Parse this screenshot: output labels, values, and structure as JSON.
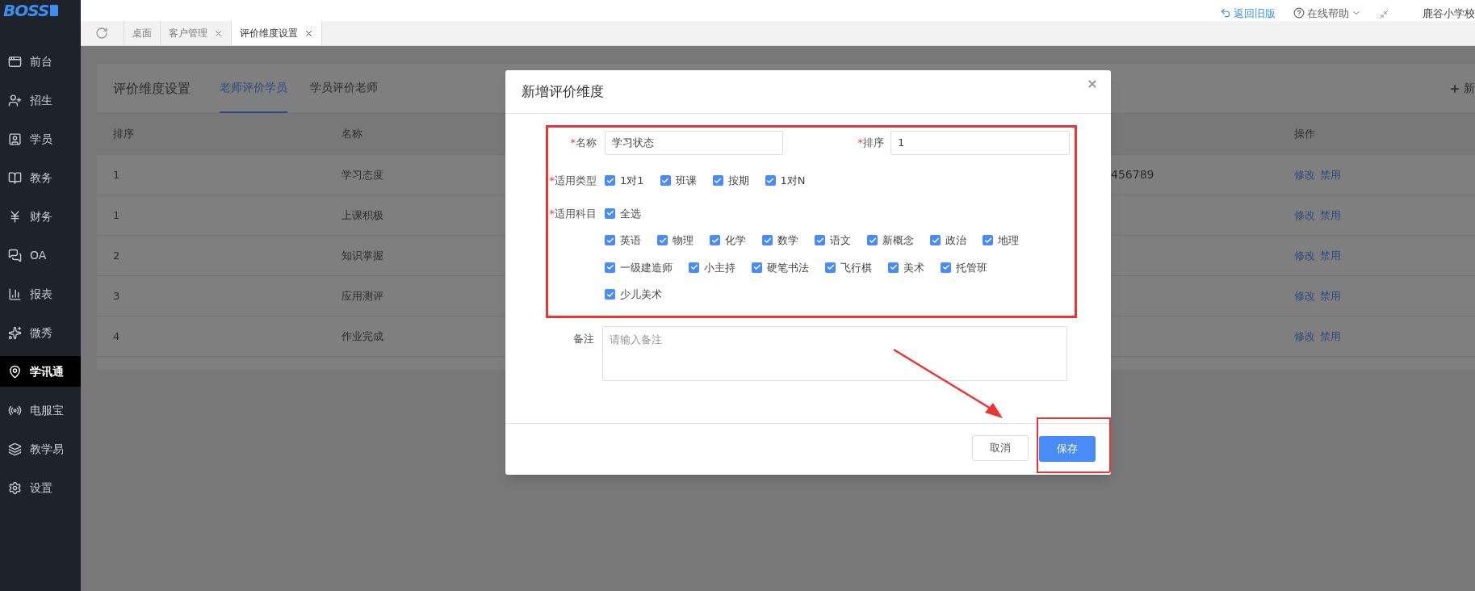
{
  "header": {
    "logo": "BOSS",
    "links": [
      {
        "label": "返回旧版"
      },
      {
        "label": "在线帮助"
      }
    ],
    "school": "鹿谷小学校"
  },
  "sidebar": {
    "items": [
      {
        "label": "前台",
        "selected": false
      },
      {
        "label": "招生",
        "selected": false
      },
      {
        "label": "学员",
        "selected": false
      },
      {
        "label": "教务",
        "selected": false
      },
      {
        "label": "财务",
        "selected": false
      },
      {
        "label": "OA",
        "selected": false
      },
      {
        "label": "报表",
        "selected": false
      },
      {
        "label": "微秀",
        "selected": false
      },
      {
        "label": "学讯通",
        "selected": true
      },
      {
        "label": "电服宝",
        "selected": false
      },
      {
        "label": "教学易",
        "selected": false
      },
      {
        "label": "设置",
        "selected": false
      }
    ]
  },
  "page_tabs": [
    {
      "label": "桌面",
      "selected": false,
      "closable": false
    },
    {
      "label": "客户管理",
      "selected": false,
      "closable": true
    },
    {
      "label": "评价维度设置",
      "selected": true,
      "closable": true
    }
  ],
  "panel": {
    "title": "评价维度设置",
    "tabs": [
      {
        "label": "老师评价学员",
        "selected": true
      },
      {
        "label": "学员评价老师",
        "selected": false
      }
    ],
    "add_button": "新",
    "table": {
      "columns": [
        "排序",
        "名称",
        "操作"
      ],
      "rows": [
        {
          "order": "1",
          "name": "学习态度",
          "column_3": "456789",
          "actions": [
            "修改",
            "禁用"
          ]
        },
        {
          "order": "1",
          "name": "上课积极",
          "actions": [
            "修改",
            "禁用"
          ]
        },
        {
          "order": "2",
          "name": "知识掌握",
          "actions": [
            "修改",
            "禁用"
          ]
        },
        {
          "order": "3",
          "name": "应用测评",
          "actions": [
            "修改",
            "禁用"
          ]
        },
        {
          "order": "4",
          "name": "作业完成",
          "actions": [
            "修改",
            "禁用"
          ]
        }
      ]
    }
  },
  "dialog": {
    "title": "新增评价维度",
    "fields": [
      {
        "mark": "*",
        "label": "名称",
        "value": "学习状态"
      },
      {
        "mark": "*",
        "label": "排序",
        "value": "1"
      }
    ],
    "types": {
      "mark": "*",
      "label": "适用类型",
      "options": [
        {
          "label": "1对1",
          "checked": true
        },
        {
          "label": "班课",
          "checked": true
        },
        {
          "label": "按期",
          "checked": true
        },
        {
          "label": "1对N",
          "checked": true
        }
      ]
    },
    "subjects": {
      "mark": "*",
      "label": "适用科目",
      "select_all": {
        "label": "全选",
        "checked": true
      },
      "options": [
        {
          "label": "英语",
          "checked": true
        },
        {
          "label": "物理",
          "checked": true
        },
        {
          "label": "化学",
          "checked": true
        },
        {
          "label": "数学",
          "checked": true
        },
        {
          "label": "语文",
          "checked": true
        },
        {
          "label": "新概念",
          "checked": true
        },
        {
          "label": "政治",
          "checked": true
        },
        {
          "label": "地理",
          "checked": true
        },
        {
          "label": "一级建造师",
          "checked": true
        },
        {
          "label": "小主持",
          "checked": true
        },
        {
          "label": "硬笔书法",
          "checked": true
        },
        {
          "label": "飞行棋",
          "checked": true
        },
        {
          "label": "美术",
          "checked": true
        },
        {
          "label": "托管班",
          "checked": true
        },
        {
          "label": "少儿美术",
          "checked": true
        }
      ]
    },
    "remark": {
      "label": "备注",
      "placeholder": "请输入备注"
    },
    "buttons": [
      {
        "label": "取消",
        "kind": "secondary"
      },
      {
        "label": "保存",
        "kind": "primary"
      }
    ]
  }
}
